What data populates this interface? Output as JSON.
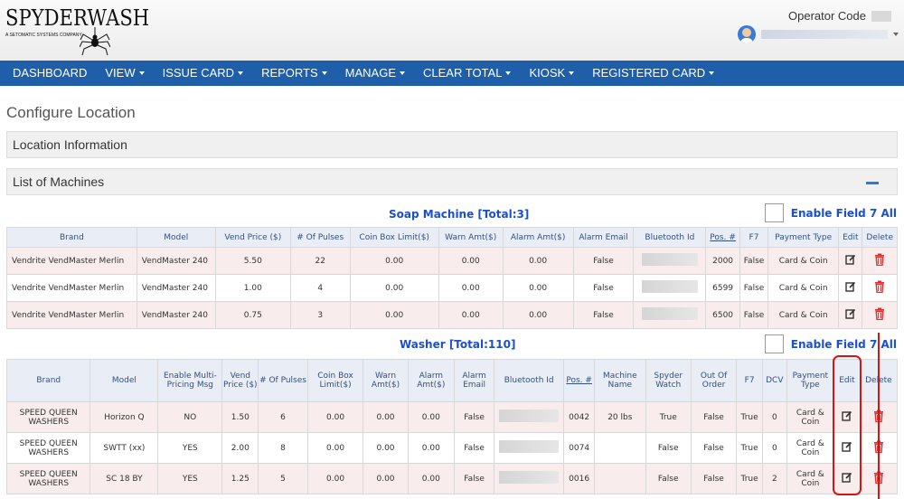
{
  "app": {
    "logo_text": "SPYDERWASH",
    "logo_sub": "A SETOMATIC SYSTEMS COMPANY",
    "operator_label": "Operator Code"
  },
  "nav": [
    {
      "label": "DASHBOARD",
      "caret": false
    },
    {
      "label": "VIEW",
      "caret": true
    },
    {
      "label": "ISSUE CARD",
      "caret": true
    },
    {
      "label": "REPORTS",
      "caret": true
    },
    {
      "label": "MANAGE",
      "caret": true
    },
    {
      "label": "CLEAR TOTAL",
      "caret": true
    },
    {
      "label": "KIOSK",
      "caret": true
    },
    {
      "label": "REGISTERED CARD",
      "caret": true
    }
  ],
  "page_title": "Configure Location",
  "panels": {
    "location_info": "Location Information",
    "list_of_machines": "List of Machines"
  },
  "soap": {
    "title": "Soap Machine [Total:3]",
    "enable_f7_label": "Enable Field 7 All",
    "headers": [
      "Brand",
      "Model",
      "Vend Price ($)",
      "# Of Pulses",
      "Coin Box Limit($)",
      "Warn Amt($)",
      "Alarm Amt($)",
      "Alarm Email",
      "Bluetooth Id",
      "Pos. #",
      "F7",
      "Payment Type",
      "Edit",
      "Delete"
    ],
    "rows": [
      {
        "brand": "Vendrite VendMaster Merlin",
        "model": "VendMaster 240",
        "vend_price": "5.50",
        "pulses": "22",
        "coin_box": "0.00",
        "warn": "0.00",
        "alarm": "0.00",
        "alarm_email": "False",
        "pos": "2000",
        "f7": "False",
        "payment": "Card & Coin"
      },
      {
        "brand": "Vendrite VendMaster Merlin",
        "model": "VendMaster 240",
        "vend_price": "1.00",
        "pulses": "4",
        "coin_box": "0.00",
        "warn": "0.00",
        "alarm": "0.00",
        "alarm_email": "False",
        "pos": "6599",
        "f7": "False",
        "payment": "Card & Coin"
      },
      {
        "brand": "Vendrite VendMaster Merlin",
        "model": "VendMaster 240",
        "vend_price": "0.75",
        "pulses": "3",
        "coin_box": "0.00",
        "warn": "0.00",
        "alarm": "0.00",
        "alarm_email": "False",
        "pos": "6500",
        "f7": "False",
        "payment": "Card & Coin"
      }
    ]
  },
  "washer": {
    "title": "Washer [Total:110]",
    "enable_f7_label": "Enable Field 7 All",
    "headers": [
      "Brand",
      "Model",
      "Enable Multi-Pricing Msg",
      "Vend Price ($)",
      "# Of Pulses",
      "Coin Box Limit($)",
      "Warn Amt($)",
      "Alarm Amt($)",
      "Alarm Email",
      "Bluetooth Id",
      "Pos. #",
      "Machine Name",
      "Spyder Watch",
      "Out Of Order",
      "F7",
      "DCV",
      "Payment Type",
      "Edit",
      "Delete"
    ],
    "rows": [
      {
        "brand": "SPEED QUEEN WASHERS",
        "model": "Horizon Q",
        "multi": "NO",
        "vend_price": "1.50",
        "pulses": "6",
        "coin_box": "0.00",
        "warn": "0.00",
        "alarm": "0.00",
        "alarm_email": "False",
        "pos": "0042",
        "name": "20 lbs",
        "spyder": "True",
        "ooo": "False",
        "f7": "True",
        "dcv": "0",
        "payment": "Card & Coin"
      },
      {
        "brand": "SPEED QUEEN WASHERS",
        "model": "SWTT (xx)",
        "multi": "YES",
        "vend_price": "2.00",
        "pulses": "8",
        "coin_box": "0.00",
        "warn": "0.00",
        "alarm": "0.00",
        "alarm_email": "False",
        "pos": "0074",
        "name": "",
        "spyder": "False",
        "ooo": "False",
        "f7": "True",
        "dcv": "0",
        "payment": "Card & Coin"
      },
      {
        "brand": "SPEED QUEEN WASHERS",
        "model": "SC 18 BY",
        "multi": "YES",
        "vend_price": "1.25",
        "pulses": "5",
        "coin_box": "0.00",
        "warn": "0.00",
        "alarm": "0.00",
        "alarm_email": "False",
        "pos": "0016",
        "name": "",
        "spyder": "False",
        "ooo": "False",
        "f7": "True",
        "dcv": "2",
        "payment": "Card & Coin"
      }
    ]
  },
  "colors": {
    "nav_bg": "#1f5ea8",
    "section_title": "#1a4fd0",
    "delete_icon": "#e03030",
    "highlight": "#d51414"
  },
  "icons": {
    "edit": "edit-icon",
    "delete": "trash-icon",
    "user": "user-avatar-icon"
  }
}
